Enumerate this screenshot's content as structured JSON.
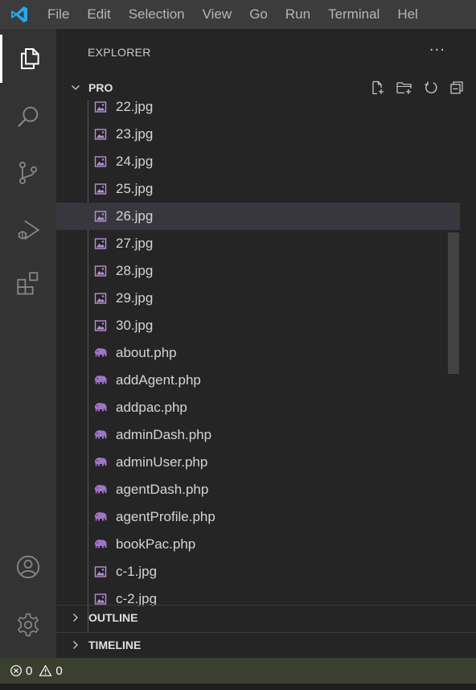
{
  "menu": {
    "items": [
      "File",
      "Edit",
      "Selection",
      "View",
      "Go",
      "Run",
      "Terminal",
      "Hel"
    ]
  },
  "activity": {
    "icons": [
      "files-icon",
      "search-icon",
      "source-control-icon",
      "run-debug-icon",
      "extensions-icon",
      "account-icon",
      "settings-gear-icon"
    ]
  },
  "explorer": {
    "title": "EXPLORER",
    "more": "···",
    "folder": "PRO",
    "files": [
      {
        "name": "22.jpg",
        "type": "image"
      },
      {
        "name": "23.jpg",
        "type": "image"
      },
      {
        "name": "24.jpg",
        "type": "image"
      },
      {
        "name": "25.jpg",
        "type": "image"
      },
      {
        "name": "26.jpg",
        "type": "image",
        "selected": true
      },
      {
        "name": "27.jpg",
        "type": "image"
      },
      {
        "name": "28.jpg",
        "type": "image"
      },
      {
        "name": "29.jpg",
        "type": "image"
      },
      {
        "name": "30.jpg",
        "type": "image"
      },
      {
        "name": "about.php",
        "type": "php"
      },
      {
        "name": "addAgent.php",
        "type": "php"
      },
      {
        "name": "addpac.php",
        "type": "php"
      },
      {
        "name": "adminDash.php",
        "type": "php"
      },
      {
        "name": "adminUser.php",
        "type": "php"
      },
      {
        "name": "agentDash.php",
        "type": "php"
      },
      {
        "name": "agentProfile.php",
        "type": "php"
      },
      {
        "name": "bookPac.php",
        "type": "php"
      },
      {
        "name": "c-1.jpg",
        "type": "image"
      },
      {
        "name": "c-2.jpg",
        "type": "image"
      }
    ],
    "outline": "OUTLINE",
    "timeline": "TIMELINE"
  },
  "status": {
    "errors": "0",
    "warnings": "0"
  },
  "colors": {
    "titlebar": "#3c3c3c",
    "activitybar": "#333333",
    "sidebar": "#252526",
    "selected_row": "#37373d",
    "vscode_blue": "#23a9f2",
    "image_icon": "#a074c4",
    "php_icon": "#a074c4"
  }
}
